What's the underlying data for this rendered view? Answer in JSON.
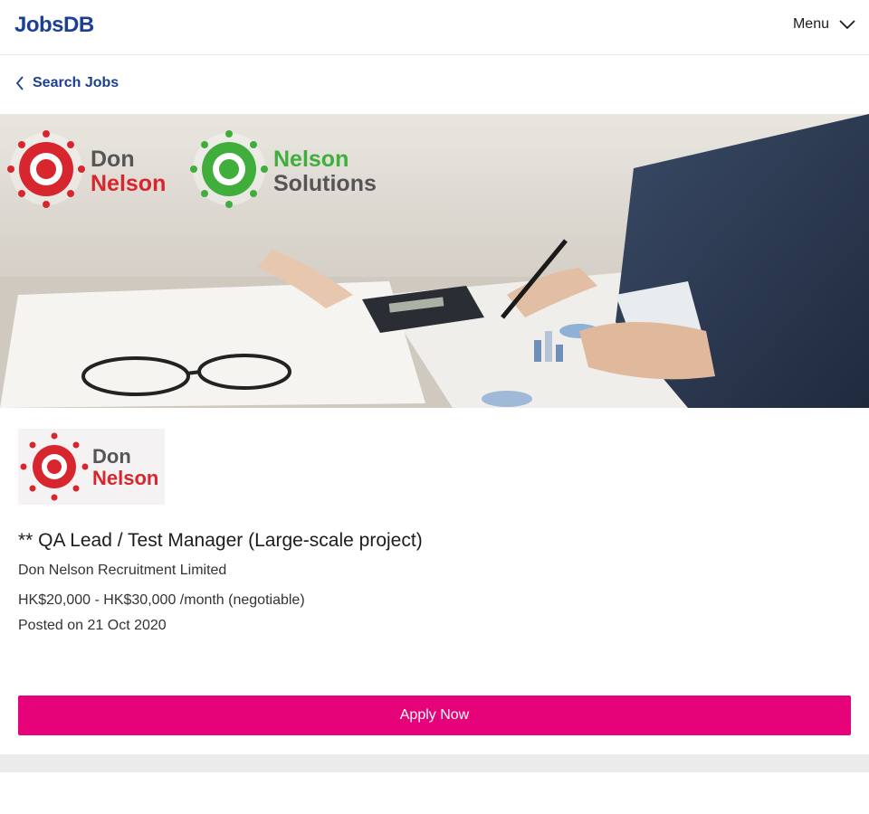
{
  "header": {
    "brand": "JobsDB",
    "menu_label": "Menu",
    "menu_icon": "chevron-down-icon"
  },
  "breadcrumb": {
    "icon": "chevron-left-icon",
    "label": "Search Jobs"
  },
  "banner": {
    "logo_primary_line1": "Don",
    "logo_primary_line2": "Nelson",
    "logo_secondary_line1": "Nelson",
    "logo_secondary_line2": "Solutions"
  },
  "company_logo": {
    "line1": "Don",
    "line2": "Nelson"
  },
  "job": {
    "title": "** QA Lead / Test Manager (Large-scale project)",
    "company": "Don Nelson Recruitment Limited",
    "salary": "HK$20,000 - HK$30,000 /month (negotiable)",
    "posted": "Posted on 21 Oct 2020"
  },
  "actions": {
    "apply_label": "Apply Now"
  },
  "colors": {
    "brand": "#1c3f94",
    "apply": "#e60278",
    "logo_red": "#d7262e",
    "logo_green": "#3fae3a"
  }
}
